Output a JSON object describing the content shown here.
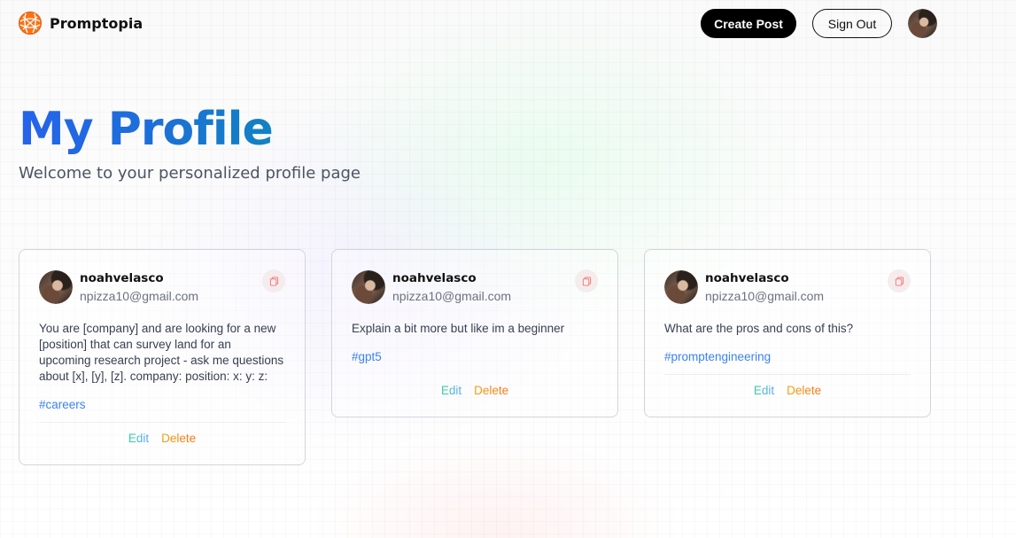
{
  "app": {
    "name": "Promptopia"
  },
  "nav": {
    "create_label": "Create Post",
    "signout_label": "Sign Out"
  },
  "profile": {
    "title": "My Profile",
    "subtitle": "Welcome to your personalized profile page"
  },
  "posts": [
    {
      "username": "noahvelasco",
      "email": "npizza10@gmail.com",
      "prompt": "You are [company] and are looking for a new [position] that can survey land for an upcoming research project - ask me questions about [x], [y], [z]. company: position: x: y: z:",
      "tag": "#careers",
      "edit_label": "Edit",
      "delete_label": "Delete"
    },
    {
      "username": "noahvelasco",
      "email": "npizza10@gmail.com",
      "prompt": "Explain a bit more but like im a beginner",
      "tag": "#gpt5",
      "edit_label": "Edit",
      "delete_label": "Delete"
    },
    {
      "username": "noahvelasco",
      "email": "npizza10@gmail.com",
      "prompt": "What are the pros and cons of this?",
      "tag": "#promptengineering",
      "edit_label": "Edit",
      "delete_label": "Delete"
    }
  ],
  "colors": {
    "brand": "#f97316",
    "title_gradient_start": "#2563eb",
    "title_gradient_end": "#0891b2",
    "tag": "#3b82f6"
  }
}
